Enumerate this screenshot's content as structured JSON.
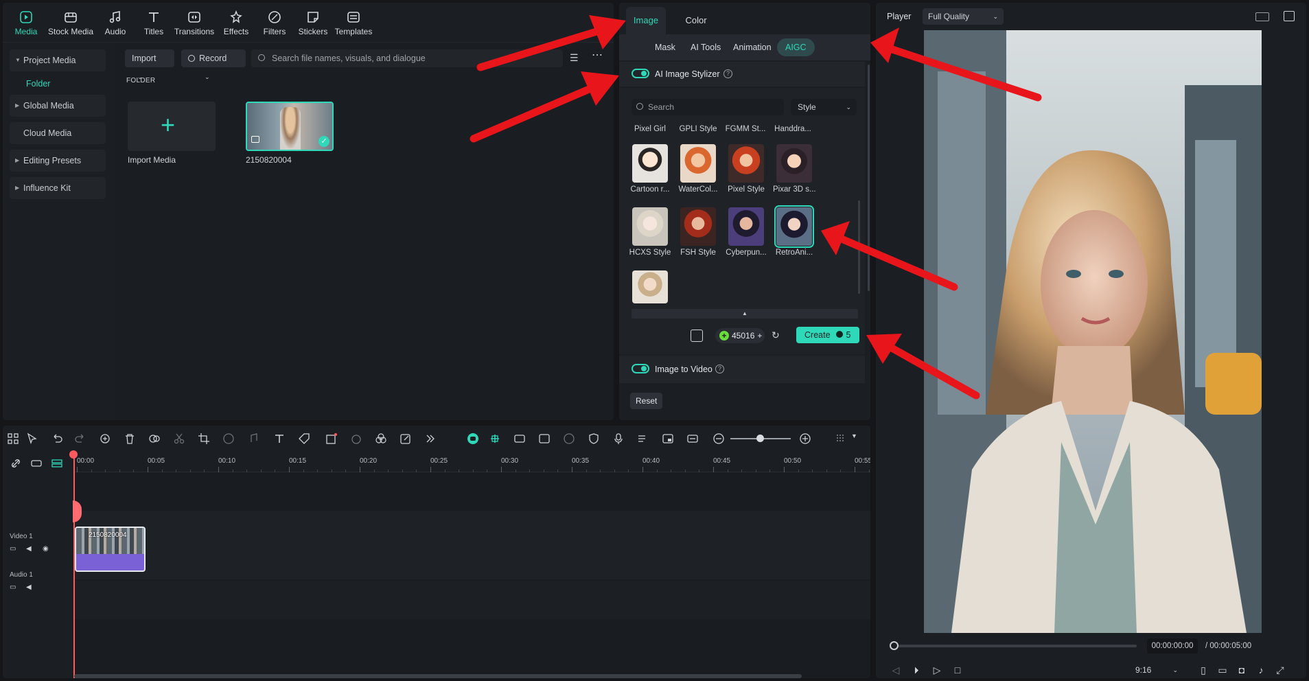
{
  "toolbar": {
    "tools": [
      {
        "label": "Media",
        "icon": "media-icon",
        "active": true
      },
      {
        "label": "Stock Media",
        "icon": "stock-media-icon"
      },
      {
        "label": "Audio",
        "icon": "audio-icon"
      },
      {
        "label": "Titles",
        "icon": "titles-icon"
      },
      {
        "label": "Transitions",
        "icon": "transitions-icon"
      },
      {
        "label": "Effects",
        "icon": "effects-icon"
      },
      {
        "label": "Filters",
        "icon": "filters-icon"
      },
      {
        "label": "Stickers",
        "icon": "stickers-icon"
      },
      {
        "label": "Templates",
        "icon": "templates-icon"
      }
    ]
  },
  "sidebar": {
    "items": [
      {
        "label": "Project Media"
      },
      {
        "label": "Folder"
      },
      {
        "label": "Global Media"
      },
      {
        "label": "Cloud Media"
      },
      {
        "label": "Editing Presets"
      },
      {
        "label": "Influence Kit"
      }
    ]
  },
  "media": {
    "import_label": "Import",
    "record_label": "Record",
    "search_placeholder": "Search file names, visuals, and dialogue",
    "folder_heading": "FOLDER",
    "import_tile_caption": "Import Media",
    "clip_name": "2150820004"
  },
  "props": {
    "tabs": [
      "Image",
      "Color"
    ],
    "subtabs": [
      "Mask",
      "AI Tools",
      "Animation",
      "AIGC"
    ],
    "stylizer_title": "AI Image Stylizer",
    "search_placeholder": "Search",
    "style_select": "Style",
    "top_row_captions": [
      "Pixel Girl",
      "GPLI Style",
      "FGMM St...",
      "Handdra..."
    ],
    "styles": [
      {
        "caption": "Cartoon r..."
      },
      {
        "caption": "WaterCol..."
      },
      {
        "caption": "Pixel Style"
      },
      {
        "caption": "Pixar 3D s..."
      },
      {
        "caption": "HCXS Style"
      },
      {
        "caption": "FSH Style"
      },
      {
        "caption": "Cyberpun..."
      },
      {
        "caption": "RetroAni...",
        "selected": true
      },
      {
        "caption": ""
      }
    ],
    "credits": "45016",
    "create_label": "Create",
    "create_cost": "5",
    "image_to_video": "Image to Video",
    "reset_label": "Reset"
  },
  "player": {
    "title": "Player",
    "quality": "Full Quality",
    "current_time": "00:00:00:00",
    "total_time": "/ 00:00:05:00",
    "ratio": "9:16"
  },
  "timeline": {
    "ticks": [
      "00:00",
      "00:05",
      "00:10",
      "00:15",
      "00:20",
      "00:25",
      "00:30",
      "00:35",
      "00:40",
      "00:45",
      "00:50",
      "00:55"
    ],
    "video_track": "Video 1",
    "audio_track": "Audio 1",
    "clip_label": "2150820004"
  },
  "colors": {
    "accent": "#2fd8b8",
    "playhead": "#ff5a5f",
    "annotation": "#e8161b"
  }
}
